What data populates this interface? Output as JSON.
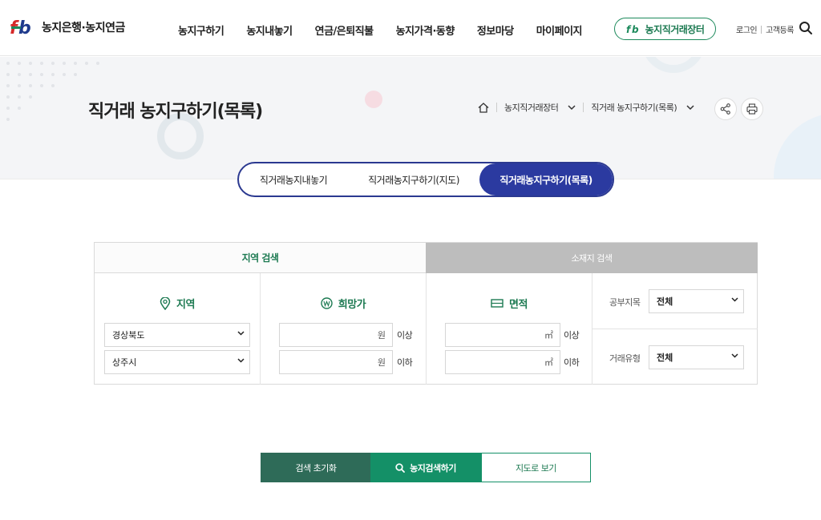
{
  "header": {
    "logo_text": "농지은행·농지연금",
    "nav": [
      "농지구하기",
      "농지내놓기",
      "연금/은퇴직불",
      "농지가격·동향",
      "정보마당",
      "마이페이지"
    ],
    "market_button": "농지직거래장터",
    "login": "로그인",
    "register": "고객등록"
  },
  "banner": {
    "title": "직거래 농지구하기(목록)",
    "breadcrumb": [
      "농지직거래장터",
      "직거래 농지구하기(목록)"
    ]
  },
  "tabs": [
    "직거래농지내놓기",
    "직거래농지구하기(지도)",
    "직거래농지구하기(목록)"
  ],
  "search_panel": {
    "tab_region": "지역 검색",
    "tab_address": "소재지 검색",
    "region": {
      "title": "지역",
      "province": "경상북도",
      "city": "상주시"
    },
    "price": {
      "title": "희망가",
      "unit": "원",
      "min_suffix": "이상",
      "max_suffix": "이하"
    },
    "area": {
      "title": "면적",
      "unit": "㎡",
      "min_suffix": "이상",
      "max_suffix": "이하"
    },
    "land_category": {
      "label": "공부지목",
      "value": "전체"
    },
    "deal_type": {
      "label": "거래유형",
      "value": "전체"
    }
  },
  "buttons": {
    "reset": "검색 초기화",
    "search": "농지검색하기",
    "map": "지도로 보기"
  },
  "colors": {
    "brand_green": "#149067",
    "tab_active": "#2b3aa0",
    "reset_bg": "#2e6b58"
  }
}
